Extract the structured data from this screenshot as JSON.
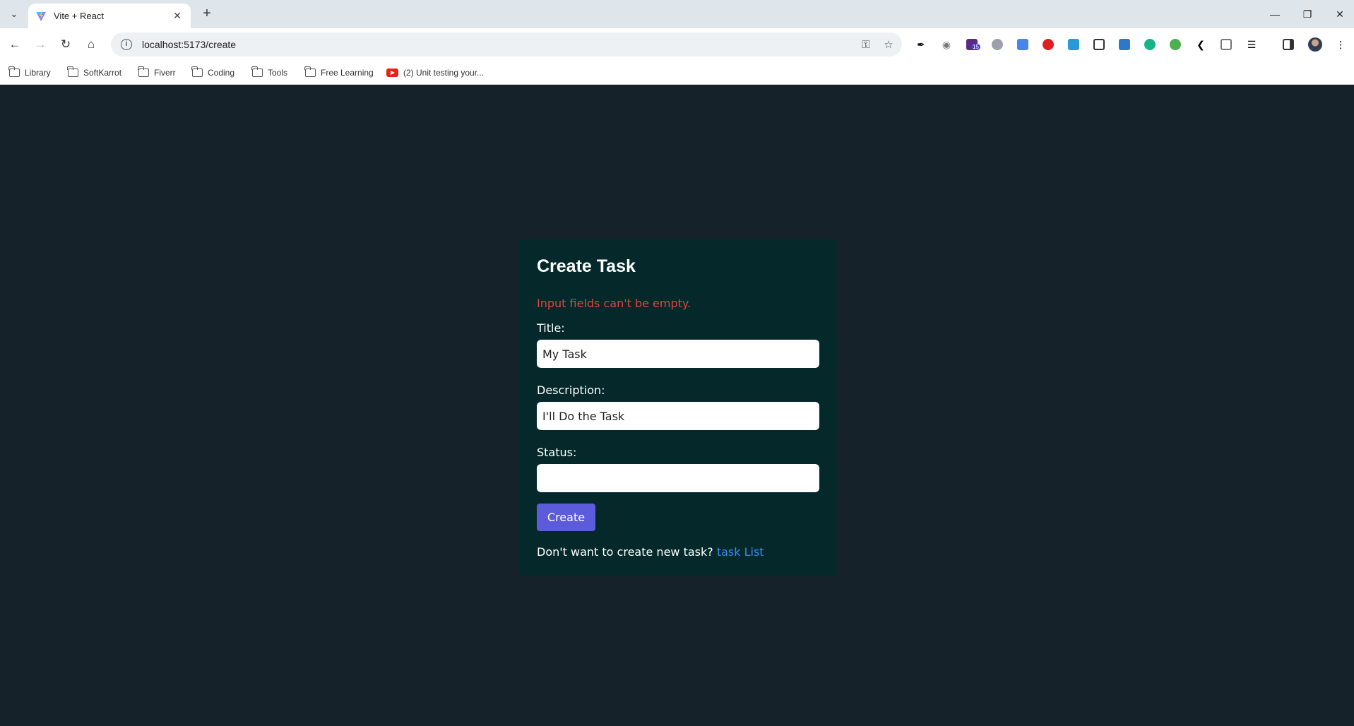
{
  "browser": {
    "tab": {
      "title": "Vite + React"
    },
    "address_bar": {
      "url": "localhost:5173/create"
    },
    "extension_badge": "15",
    "bookmarks": [
      {
        "label": "Library",
        "icon": "folder-icon"
      },
      {
        "label": "SoftKarrot",
        "icon": "folder-icon"
      },
      {
        "label": "Fiverr",
        "icon": "folder-icon"
      },
      {
        "label": "Coding",
        "icon": "folder-icon"
      },
      {
        "label": "Tools",
        "icon": "folder-icon"
      },
      {
        "label": "Free Learning",
        "icon": "folder-icon"
      },
      {
        "label": "(2) Unit testing your...",
        "icon": "youtube-icon"
      }
    ]
  },
  "form": {
    "title": "Create Task",
    "error": "Input fields can't be empty.",
    "fields": {
      "title": {
        "label": "Title:",
        "value": "My Task"
      },
      "description": {
        "label": "Description:",
        "value": "I'll Do the Task"
      },
      "status": {
        "label": "Status:",
        "value": ""
      }
    },
    "submit_label": "Create",
    "footer_text": "Don't want to create new task?",
    "footer_link": "task List"
  },
  "colors": {
    "page_background": "#16222a",
    "card_background": "#05292a",
    "error": "#e0443b",
    "button": "#5b5bdb",
    "link": "#3b8af0"
  }
}
